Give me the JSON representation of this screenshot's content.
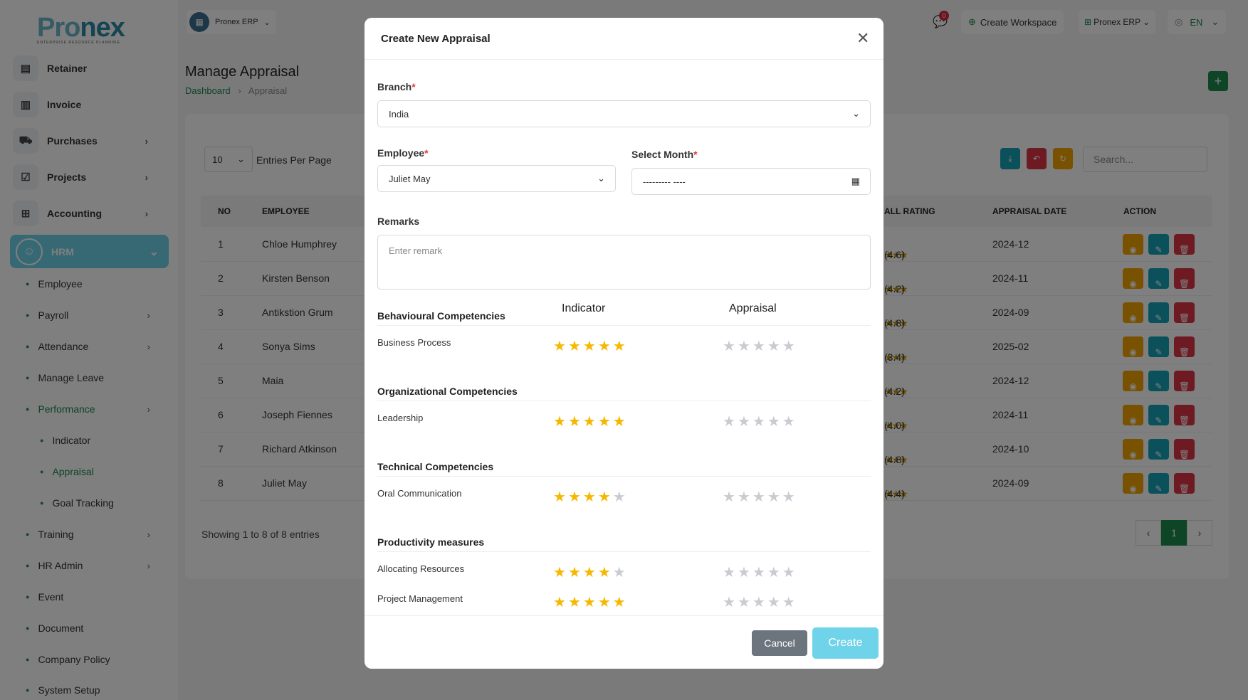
{
  "brand": {
    "logo_a": "Pro",
    "logo_b": "nex",
    "logo_tagline": "ENTERPRISE RESOURCE PLANNING"
  },
  "sidebar": {
    "top_items": [
      {
        "label": "Retainer",
        "icon": "retainer-icon",
        "has_chevron": false
      },
      {
        "label": "Invoice",
        "icon": "invoice-icon",
        "has_chevron": false
      },
      {
        "label": "Purchases",
        "icon": "cart-icon",
        "has_chevron": true
      },
      {
        "label": "Projects",
        "icon": "projects-icon",
        "has_chevron": true
      },
      {
        "label": "Accounting",
        "icon": "accounting-icon",
        "has_chevron": true
      }
    ],
    "active_group": "HRM",
    "hrm_items": [
      "Employee",
      "Payroll",
      "Attendance",
      "Manage Leave",
      "Performance",
      "Training",
      "HR Admin",
      "Event",
      "Document",
      "Company Policy",
      "System Setup"
    ],
    "performance_items": [
      "Indicator",
      "Appraisal",
      "Goal Tracking"
    ]
  },
  "header": {
    "workspace": "Pronex ERP",
    "notification_count": "0",
    "create_workspace": "Create Workspace",
    "erp_menu": "Pronex ERP",
    "language": "EN"
  },
  "page": {
    "title": "Manage Appraisal",
    "breadcrumb_home": "Dashboard",
    "breadcrumb_current": "Appraisal",
    "entries_value": "10",
    "entries_label": "Entries Per Page",
    "search_placeholder": "Search...",
    "showing": "Showing 1 to 8 of 8 entries",
    "current_page": "1"
  },
  "table": {
    "headers": {
      "no": "NO",
      "employee": "EMPLOYEE",
      "rating": "ALL RATING",
      "date": "APPRAISAL DATE",
      "action": "ACTION"
    },
    "rows": [
      {
        "no": "1",
        "employee": "Chloe Humphrey",
        "rating": "(4.6)",
        "date": "2024-12"
      },
      {
        "no": "2",
        "employee": "Kirsten Benson",
        "rating": "(4.2)",
        "date": "2024-11"
      },
      {
        "no": "3",
        "employee": "Antikstion Grum",
        "rating": "(4.8)",
        "date": "2024-09"
      },
      {
        "no": "4",
        "employee": "Sonya Sims",
        "rating": "(3.4)",
        "date": "2025-02"
      },
      {
        "no": "5",
        "employee": "Maia",
        "rating": "(4.2)",
        "date": "2024-12"
      },
      {
        "no": "6",
        "employee": "Joseph Fiennes",
        "rating": "(4.0)",
        "date": "2024-11"
      },
      {
        "no": "7",
        "employee": "Richard Atkinson",
        "rating": "(4.8)",
        "date": "2024-10"
      },
      {
        "no": "8",
        "employee": "Juliet May",
        "rating": "(4.4)",
        "date": "2024-09"
      }
    ]
  },
  "modal": {
    "title": "Create New Appraisal",
    "branch_label": "Branch",
    "branch_value": "India",
    "employee_label": "Employee",
    "employee_value": "Juliet May",
    "month_label": "Select Month",
    "month_value": "--------- ----",
    "remarks_label": "Remarks",
    "remarks_placeholder": "Enter remark",
    "col_indicator": "Indicator",
    "col_appraisal": "Appraisal",
    "sections": [
      {
        "title": "Behavioural Competencies",
        "criteria": [
          {
            "name": "Business Process",
            "indicator": 5,
            "appraisal": 0
          }
        ]
      },
      {
        "title": "Organizational Competencies",
        "criteria": [
          {
            "name": "Leadership",
            "indicator": 5,
            "appraisal": 0
          }
        ]
      },
      {
        "title": "Technical Competencies",
        "criteria": [
          {
            "name": "Oral Communication",
            "indicator": 4,
            "appraisal": 0
          }
        ]
      },
      {
        "title": "Productivity measures",
        "criteria": [
          {
            "name": "Allocating Resources",
            "indicator": 4,
            "appraisal": 0
          },
          {
            "name": "Project Management",
            "indicator": 5,
            "appraisal": 0
          }
        ]
      }
    ],
    "cancel_label": "Cancel",
    "create_label": "Create"
  },
  "colors": {
    "accent": "#6fd3ea",
    "primary_green": "#1c8a4c",
    "star": "#f5b800",
    "view": "#f0a400",
    "edit": "#17a2b8",
    "delete": "#dc3545"
  }
}
